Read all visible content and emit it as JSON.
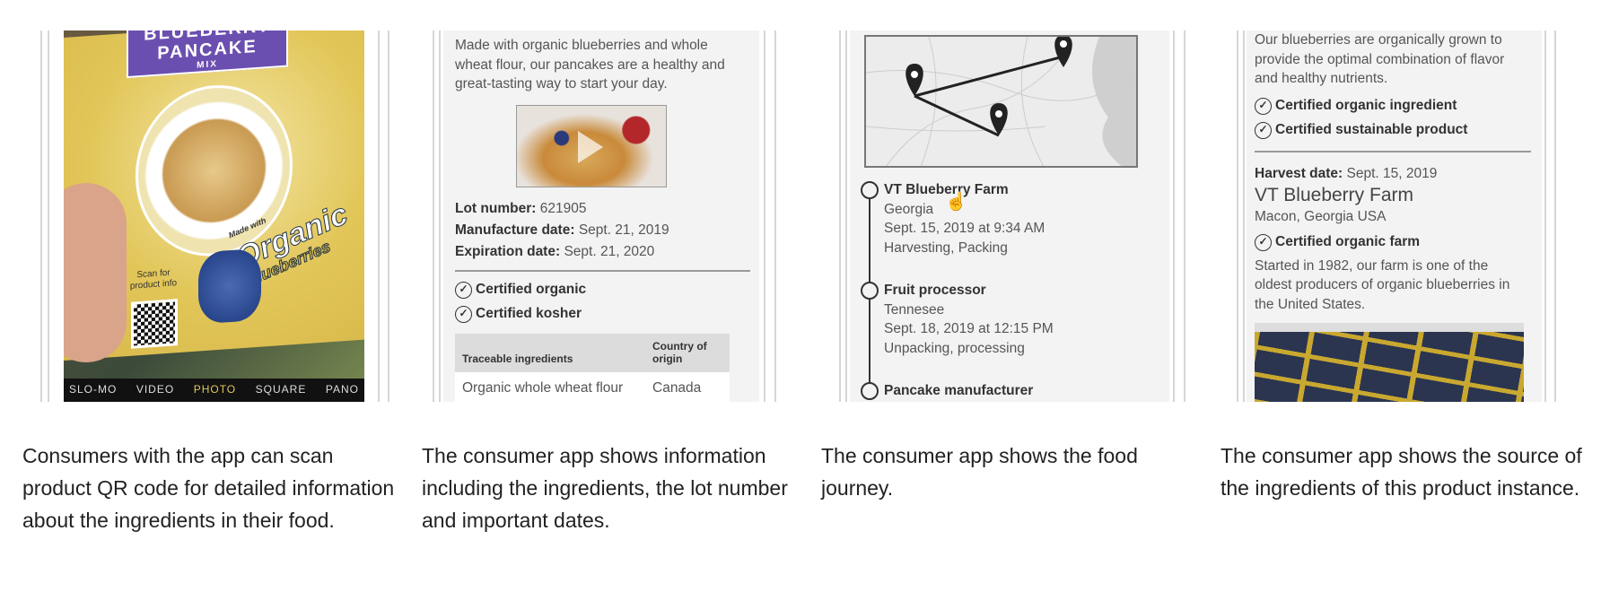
{
  "panels": [
    {
      "package": {
        "brand_line1": "BLUEBERRY",
        "brand_line2": "PANCAKE",
        "brand_line3": "MIX",
        "made_with": "Made with",
        "organic": "Organic",
        "blueberries": "Blueberries",
        "scan_text": "Scan for product info"
      },
      "camera_modes": [
        "SLO-MO",
        "VIDEO",
        "PHOTO",
        "SQUARE",
        "PANO"
      ],
      "caption": "Consumers with the app can scan product QR code for detailed information about the ingredients in their food."
    },
    {
      "intro": "Made with organic blueberries and whole wheat flour, our pancakes are a healthy and great-tasting way to start your day.",
      "lot_label": "Lot number:",
      "lot_value": "621905",
      "manufacture_label": "Manufacture date:",
      "manufacture_value": "Sept. 21, 2019",
      "expiration_label": "Expiration date:",
      "expiration_value": "Sept. 21, 2020",
      "certs": [
        "Certified organic",
        "Certified kosher"
      ],
      "table": {
        "headers": [
          "Traceable ingredients",
          "Country of origin"
        ],
        "rows": [
          [
            "Organic whole wheat flour",
            "Canada"
          ]
        ]
      },
      "caption": "The consumer app shows information including the ingredients, the lot number and important dates."
    },
    {
      "timeline": [
        {
          "title": "VT Blueberry Farm",
          "location": "Georgia",
          "time": "Sept. 15, 2019 at 9:34 AM",
          "activity": "Harvesting, Packing"
        },
        {
          "title": "Fruit processor",
          "location": "Tennesee",
          "time": "Sept. 18, 2019 at 12:15 PM",
          "activity": "Unpacking, processing"
        },
        {
          "title": "Pancake manufacturer"
        }
      ],
      "caption": "The consumer app shows the food journey."
    },
    {
      "intro": "Our blueberries are organically grown to provide the optimal combination of flavor and healthy nutrients.",
      "certs": [
        "Certified organic ingredient",
        "Certified sustainable product"
      ],
      "harvest_label": "Harvest date:",
      "harvest_value": "Sept. 15, 2019",
      "farm_name": "VT Blueberry Farm",
      "farm_location": "Macon, Georgia USA",
      "farm_cert": "Certified organic farm",
      "farm_story": "Started in 1982, our farm is one of the oldest producers of organic blueberries in the United States.",
      "caption": "The consumer app shows the source of the ingredients of this product instance."
    }
  ],
  "colors": {
    "package_yellow": "#e2c659",
    "banner_purple": "#6b4fb0",
    "text": "#222"
  }
}
